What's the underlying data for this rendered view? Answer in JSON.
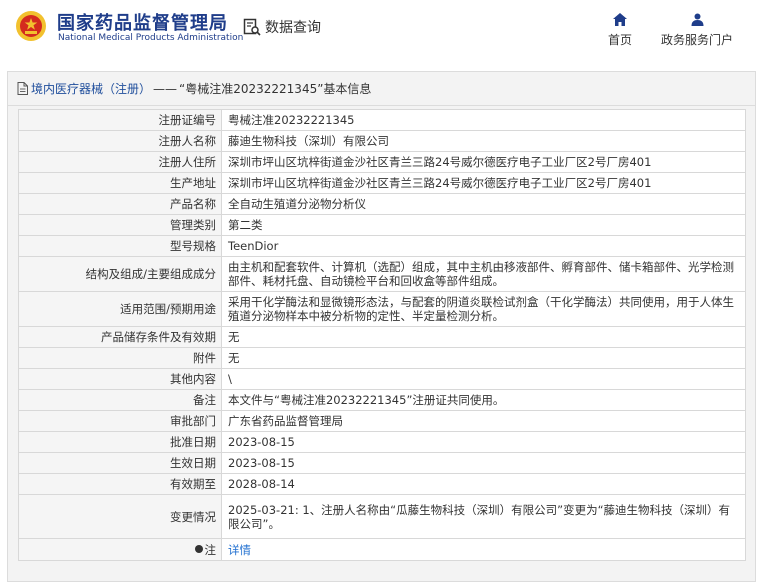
{
  "header": {
    "brand_cn": "国家药品监督管理局",
    "brand_en": "National Medical Products Administration",
    "logo_icon": "nmpa-emblem-icon",
    "query_label": "数据查询",
    "nav": {
      "home": "首页",
      "portal": "政务服务门户"
    }
  },
  "breadcrumb": {
    "category": "境内医疗器械（注册）",
    "separator": "——",
    "title": "“粤械注准20232221345”基本信息"
  },
  "rows": [
    {
      "label": "注册证编号",
      "value": "粤械注准20232221345"
    },
    {
      "label": "注册人名称",
      "value": "藤迪生物科技（深圳）有限公司"
    },
    {
      "label": "注册人住所",
      "value": "深圳市坪山区坑梓街道金沙社区青兰三路24号威尔德医疗电子工业厂区2号厂房401"
    },
    {
      "label": "生产地址",
      "value": "深圳市坪山区坑梓街道金沙社区青兰三路24号威尔德医疗电子工业厂区2号厂房401"
    },
    {
      "label": "产品名称",
      "value": "全自动生殖道分泌物分析仪"
    },
    {
      "label": "管理类别",
      "value": "第二类"
    },
    {
      "label": "型号规格",
      "value": "TeenDior"
    },
    {
      "label": "结构及组成/主要组成成分",
      "value": "由主机和配套软件、计算机（选配）组成，其中主机由移液部件、孵育部件、储卡箱部件、光学检测部件、耗材托盘、自动镜检平台和回收盒等部件组成。"
    },
    {
      "label": "适用范围/预期用途",
      "value": "采用干化学酶法和显微镜形态法，与配套的阴道炎联检试剂盒（干化学酶法）共同使用，用于人体生殖道分泌物样本中被分析物的定性、半定量检测分析。"
    },
    {
      "label": "产品储存条件及有效期",
      "value": "无"
    },
    {
      "label": "附件",
      "value": "无"
    },
    {
      "label": "其他内容",
      "value": "\\"
    },
    {
      "label": "备注",
      "value": "本文件与“粤械注准20232221345”注册证共同使用。"
    },
    {
      "label": "审批部门",
      "value": "广东省药品监督管理局"
    },
    {
      "label": "批准日期",
      "value": "2023-08-15"
    },
    {
      "label": "生效日期",
      "value": "2023-08-15"
    },
    {
      "label": "有效期至",
      "value": "2028-08-14"
    },
    {
      "label": "变更情况",
      "value": "2025-03-21: 1、注册人名称由“瓜藤生物科技（深圳）有限公司”变更为“藤迪生物科技（深圳）有限公司”。"
    },
    {
      "label": "注",
      "value": "详情"
    }
  ],
  "colors": {
    "brand_blue": "#1f3d8a",
    "link_blue": "#1f6fd0",
    "emblem_red": "#d42a1e",
    "emblem_gold": "#f2c12e"
  }
}
